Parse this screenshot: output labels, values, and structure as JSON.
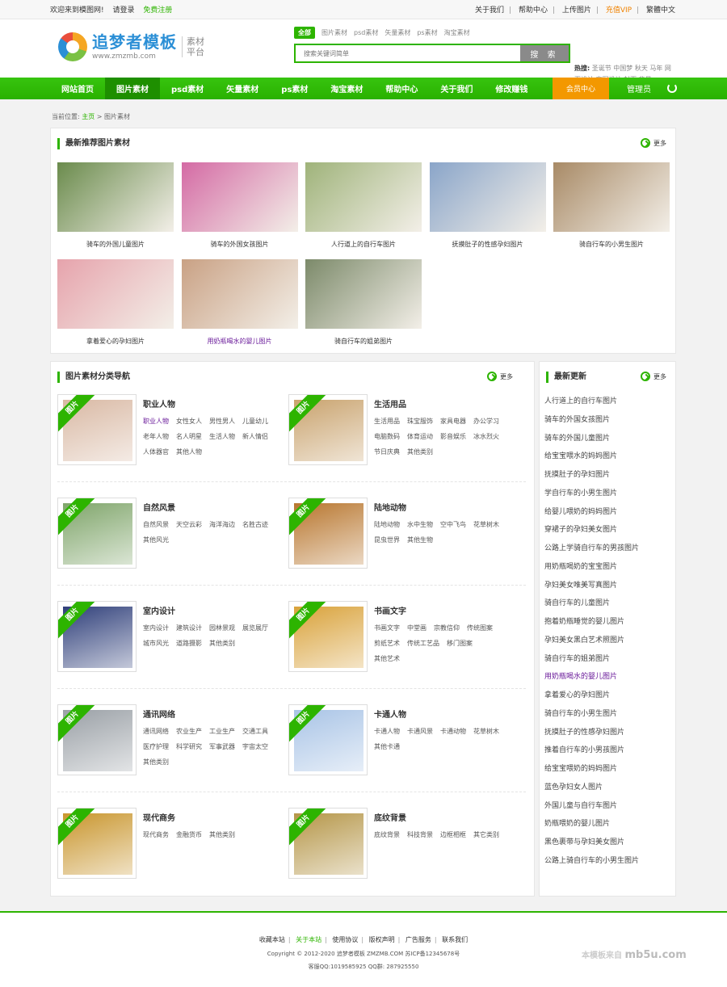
{
  "topbar": {
    "welcome": "欢迎来到模图网!",
    "login": "请登录",
    "register": "免费注册",
    "links": [
      "关于我们",
      "帮助中心",
      "上传图片",
      "充值VIP",
      "繁體中文"
    ]
  },
  "logo": {
    "title": "追梦者模板",
    "subtitle": "www.zmzmb.com",
    "side_line1": "素材",
    "side_line2": "平台"
  },
  "search": {
    "tabs": [
      "全部",
      "图片素材",
      "psd素材",
      "矢量素材",
      "ps素材",
      "淘宝素材"
    ],
    "placeholder": "搜索关键词简单",
    "button": "搜 索"
  },
  "hot": {
    "label": "热搜:",
    "words": "圣诞节 中国梦 秋天 马年 网页设计 商图设计 封面 背景"
  },
  "nav": {
    "items": [
      "网站首页",
      "图片素材",
      "psd素材",
      "矢量素材",
      "ps素材",
      "淘宝素材",
      "帮助中心",
      "关于我们",
      "修改赚钱"
    ],
    "member": "会员中心",
    "admin": "管理员"
  },
  "breadcrumb": {
    "label": "当前位置:",
    "home": "主页",
    "arrow": ">",
    "current": "图片素材"
  },
  "recommend": {
    "title": "最新推荐图片素材",
    "more": "更多",
    "photos": [
      {
        "caption": "骑车的外国儿童图片",
        "color": "#6a8b4c"
      },
      {
        "caption": "骑车的外国女孩图片",
        "color": "#d46aa4"
      },
      {
        "caption": "人行道上的自行车图片",
        "color": "#9fb37a"
      },
      {
        "caption": "抚摸肚子的性感孕妇图片",
        "color": "#8aa5c9"
      },
      {
        "caption": "骑自行车的小男生图片",
        "color": "#a88a66"
      },
      {
        "caption": "拿着爱心的孕妇图片",
        "color": "#e6a3ac"
      },
      {
        "caption": "用奶瓶喝水的婴儿图片",
        "color": "#c9a184"
      },
      {
        "caption": "骑自行车的姐弟图片",
        "color": "#7c8a6a"
      }
    ]
  },
  "categories": {
    "title": "图片素材分类导航",
    "more": "更多",
    "ribbon": "图片",
    "items": [
      {
        "title": "职业人物",
        "color": "#d9b9a4",
        "links": [
          "职业人物",
          "女性女人",
          "男性男人",
          "儿童幼儿",
          "老年人物",
          "名人明星",
          "生活人物",
          "新人情侣",
          "人体器官",
          "其他人物"
        ]
      },
      {
        "title": "生活用品",
        "color": "#c9a36e",
        "links": [
          "生活用品",
          "珠宝服饰",
          "家具电器",
          "办公学习",
          "电脑数码",
          "体育运动",
          "影音娱乐",
          "冰水烈火",
          "节日庆典",
          "其他类别"
        ]
      },
      {
        "title": "自然风景",
        "color": "#7fa56a",
        "links": [
          "自然风景",
          "天空云彩",
          "海洋海边",
          "名胜古迹",
          "其他风光"
        ]
      },
      {
        "title": "陆地动物",
        "color": "#b8762e",
        "links": [
          "陆地动物",
          "水中生物",
          "空中飞鸟",
          "花草树木",
          "昆虫世界",
          "其他生物"
        ]
      },
      {
        "title": "室内设计",
        "color": "#2f3f7a",
        "links": [
          "室内设计",
          "建筑设计",
          "园林景观",
          "展览展厅",
          "城市风光",
          "道路摄影",
          "其他类别"
        ]
      },
      {
        "title": "书画文字",
        "color": "#d9a23a",
        "links": [
          "书画文字",
          "中堂画",
          "宗教信仰",
          "传统图案",
          "剪纸艺术",
          "传统工艺品",
          "移门图案",
          "其他艺术"
        ]
      },
      {
        "title": "通讯网络",
        "color": "#9aa0a6",
        "links": [
          "通讯网络",
          "农业生产",
          "工业生产",
          "交通工具",
          "医疗护理",
          "科学研究",
          "军事武器",
          "宇宙太空",
          "其他类别"
        ]
      },
      {
        "title": "卡通人物",
        "color": "#a9c4e6",
        "links": [
          "卡通人物",
          "卡通风景",
          "卡通动物",
          "花草树木",
          "其他卡通"
        ]
      },
      {
        "title": "现代商务",
        "color": "#c9962e",
        "links": [
          "现代商务",
          "金融货币",
          "其他类别"
        ]
      },
      {
        "title": "底纹背景",
        "color": "#b59648",
        "links": [
          "底纹背景",
          "科技背景",
          "边框相框",
          "其它类别"
        ]
      }
    ]
  },
  "latest": {
    "title": "最新更新",
    "more": "更多",
    "items": [
      "人行道上的自行车图片",
      "骑车的外国女孩图片",
      "骑车的外国儿童图片",
      "给宝宝喂水的妈妈图片",
      "抚摸肚子的孕妇图片",
      "学自行车的小男生图片",
      "给婴儿喂奶的妈妈图片",
      "穿裙子的孕妇美女图片",
      "公路上学骑自行车的男孩图片",
      "用奶瓶喝奶的宝宝图片",
      "孕妇美女唯美写真图片",
      "骑自行车的儿童图片",
      "抱着奶瓶睡觉的婴儿图片",
      "孕妇美女黑白艺术照图片",
      "骑自行车的姐弟图片",
      "用奶瓶喝水的婴儿图片",
      "拿着爱心的孕妇图片",
      "骑自行车的小男生图片",
      "抚摸肚子的性感孕妇图片",
      "推着自行车的小男孩图片",
      "给宝宝喂奶的妈妈图片",
      "蓝色孕妇女人图片",
      "外国儿童与自行车图片",
      "奶瓶喂奶的婴儿图片",
      "黑色裹带与孕妇美女图片",
      "公路上骑自行车的小男生图片"
    ]
  },
  "footer": {
    "links": [
      "收藏本站",
      "关于本站",
      "使用协议",
      "版权声明",
      "广告服务",
      "联系我们"
    ],
    "copyright": "Copyright © 2012-2020 追梦者模板 ZMZMB.COM 苏ICP备12345678号",
    "qq": "客服QQ:1019585925 QQ群: 287925550",
    "watermark_prefix": "本模板来自",
    "watermark_brand": "mb5u.com"
  }
}
